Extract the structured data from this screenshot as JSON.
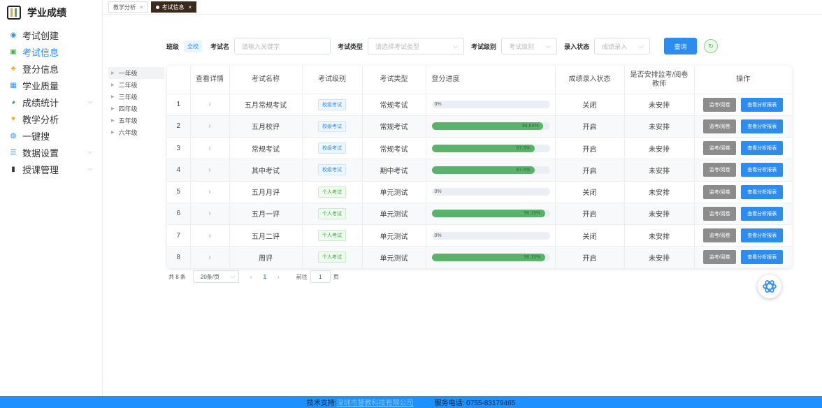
{
  "app": {
    "title": "学业成绩"
  },
  "sidebar": {
    "items": [
      {
        "label": "考试创建",
        "icon": "circle-icon",
        "color": "#2d8cf0"
      },
      {
        "label": "考试信息",
        "icon": "chart-icon",
        "color": "#4caf50",
        "active": true
      },
      {
        "label": "登分信息",
        "icon": "user-icon",
        "color": "#f5a623"
      },
      {
        "label": "学业质量",
        "icon": "grid-icon",
        "color": "#1e90ff"
      },
      {
        "label": "成绩统计",
        "icon": "pie-icon",
        "color": "#3bab3b",
        "expandable": true
      },
      {
        "label": "教学分析",
        "icon": "heart-icon",
        "color": "#f5a623"
      },
      {
        "label": "一键搜",
        "icon": "search-icon",
        "color": "#2d8cf0"
      },
      {
        "label": "数据设置",
        "icon": "sliders-icon",
        "color": "#2d8cf0",
        "expandable": true
      },
      {
        "label": "授课管理",
        "icon": "book-icon",
        "color": "#333333",
        "expandable": true
      }
    ]
  },
  "tabs": [
    {
      "label": "教学分析",
      "active": false
    },
    {
      "label": "考试信息",
      "active": true
    }
  ],
  "filters": {
    "class_label": "班级",
    "class_value": "全校",
    "exam_name_label": "考试名",
    "exam_name_placeholder": "请输入关键字",
    "exam_type_label": "考试类型",
    "exam_type_placeholder": "请选择考试类型",
    "exam_level_label": "考试级别",
    "exam_level_placeholder": "考试级别",
    "entry_status_label": "录入状态",
    "entry_status_placeholder": "成绩录入",
    "query_label": "查询"
  },
  "grades": [
    "一年级",
    "二年级",
    "三年级",
    "四年级",
    "五年级",
    "六年级"
  ],
  "table": {
    "headers": [
      "",
      "查看详情",
      "考试名称",
      "考试级别",
      "考试类型",
      "登分进度",
      "成绩录入状态",
      "是否安排监考/阅卷教师",
      "操作"
    ],
    "rows": [
      {
        "index": "1",
        "name": "五月常规考试",
        "level": "校级考试",
        "level_kind": "school",
        "type": "常规考试",
        "progress": 0,
        "progress_label": "0%",
        "status": "关闭",
        "arranged": "未安排"
      },
      {
        "index": "2",
        "name": "五月校评",
        "level": "校级考试",
        "level_kind": "school",
        "type": "常规考试",
        "progress": 94.64,
        "progress_label": "94.64%",
        "status": "开启",
        "arranged": "未安排"
      },
      {
        "index": "3",
        "name": "常规考试",
        "level": "校级考试",
        "level_kind": "school",
        "type": "常规考试",
        "progress": 87.5,
        "progress_label": "87.5%",
        "status": "开启",
        "arranged": "未安排"
      },
      {
        "index": "4",
        "name": "其中考试",
        "level": "校级考试",
        "level_kind": "school",
        "type": "期中考试",
        "progress": 87.5,
        "progress_label": "87.5%",
        "status": "开启",
        "arranged": "未安排"
      },
      {
        "index": "5",
        "name": "五月月评",
        "level": "个人考试",
        "level_kind": "personal",
        "type": "单元测试",
        "progress": 0,
        "progress_label": "0%",
        "status": "关闭",
        "arranged": "未安排"
      },
      {
        "index": "6",
        "name": "五月一评",
        "level": "个人考试",
        "level_kind": "personal",
        "type": "单元测试",
        "progress": 96.15,
        "progress_label": "96.15%",
        "status": "开启",
        "arranged": "未安排"
      },
      {
        "index": "7",
        "name": "五月二评",
        "level": "个人考试",
        "level_kind": "personal",
        "type": "单元测试",
        "progress": 0,
        "progress_label": "0%",
        "status": "关闭",
        "arranged": "未安排"
      },
      {
        "index": "8",
        "name": "周评",
        "level": "个人考试",
        "level_kind": "personal",
        "type": "单元测试",
        "progress": 96.15,
        "progress_label": "96.15%",
        "status": "开启",
        "arranged": "未安排"
      }
    ],
    "op_invigilate": "监考/阅卷",
    "op_report": "查看分析报表"
  },
  "pagination": {
    "total": "共 8 条",
    "page_size": "20条/页",
    "current": "1",
    "goto_prefix": "前往",
    "goto_value": "1",
    "goto_suffix": "页"
  },
  "footer": {
    "support_label": "技术支持:",
    "company": "深圳市慧教科技有限公司",
    "phone": "服务电话: 0755-83179465"
  },
  "colors": {
    "accent": "#1e90ff",
    "progress": "#5bb36b",
    "footer": "#1e90ff"
  }
}
